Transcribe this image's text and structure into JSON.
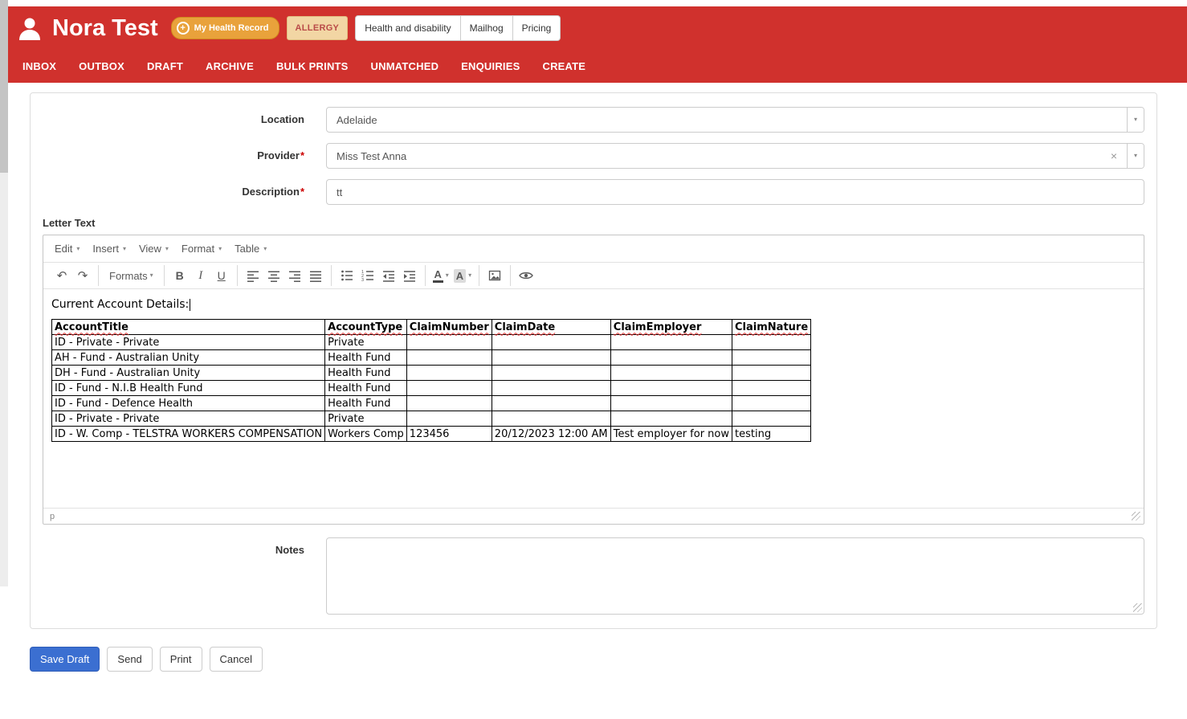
{
  "colors": {
    "header_red": "#d0312d",
    "accent_orange": "#e9a23b",
    "allergy_bg": "#f2d6a4",
    "allergy_text": "#b94a48",
    "primary_blue": "#3b6fd1"
  },
  "icons": {
    "plus": "+",
    "caret_down": "▾",
    "clear": "×",
    "undo": "↶",
    "redo": "↷",
    "bold": "B",
    "italic": "I",
    "underline": "U",
    "text_color": "A",
    "background_color": "A"
  },
  "header": {
    "title": "Nora Test",
    "my_health_record_label": "My Health Record",
    "allergy_label": "ALLERGY",
    "pills": [
      "Health and disability",
      "Mailhog",
      "Pricing"
    ],
    "nav": [
      "INBOX",
      "OUTBOX",
      "DRAFT",
      "ARCHIVE",
      "BULK PRINTS",
      "UNMATCHED",
      "ENQUIRIES",
      "CREATE"
    ]
  },
  "form": {
    "location_label": "Location",
    "location_value": "Adelaide",
    "provider_label": "Provider",
    "provider_value": "Miss Test Anna",
    "description_label": "Description",
    "description_value": "tt",
    "required_marker": "*",
    "letter_text_label": "Letter Text",
    "notes_label": "Notes",
    "notes_value": ""
  },
  "editor": {
    "menus": [
      "Edit",
      "Insert",
      "View",
      "Format",
      "Table"
    ],
    "formats_label": "Formats",
    "intro_text": "Current Account Details:",
    "status_path": "p",
    "table": {
      "headers": [
        "AccountTitle",
        "AccountType",
        "ClaimNumber",
        "ClaimDate",
        "ClaimEmployer",
        "ClaimNature"
      ],
      "rows": [
        [
          "ID - Private - Private",
          "Private",
          "",
          "",
          "",
          ""
        ],
        [
          "AH - Fund - Australian Unity",
          "Health Fund",
          "",
          "",
          "",
          ""
        ],
        [
          "DH - Fund - Australian Unity",
          "Health Fund",
          "",
          "",
          "",
          ""
        ],
        [
          "ID - Fund - N.I.B Health Fund",
          "Health Fund",
          "",
          "",
          "",
          ""
        ],
        [
          "ID - Fund - Defence Health",
          "Health Fund",
          "",
          "",
          "",
          ""
        ],
        [
          "ID - Private - Private",
          "Private",
          "",
          "",
          "",
          ""
        ],
        [
          "ID - W. Comp - TELSTRA WORKERS COMPENSATION",
          "Workers Comp",
          "123456",
          "20/12/2023 12:00 AM",
          "Test employer for now",
          "testing"
        ]
      ]
    }
  },
  "actions": {
    "save_draft": "Save Draft",
    "send": "Send",
    "print": "Print",
    "cancel": "Cancel"
  }
}
